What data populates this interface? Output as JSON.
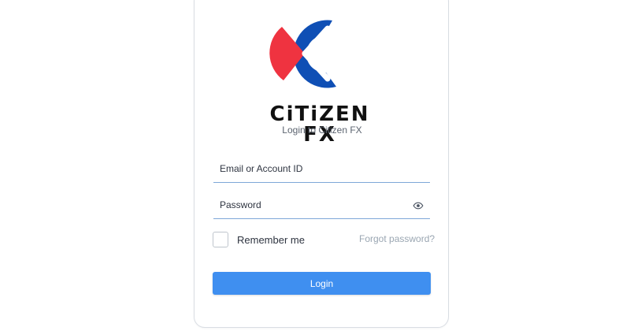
{
  "brand": {
    "name": "CiTiZEN FX",
    "logo": "citizen-fx-logo",
    "colors": {
      "blue": "#0f4fb5",
      "red": "#ef3340",
      "accent": "#3f8ff0"
    }
  },
  "login": {
    "subtitle": "Login to Citizen FX",
    "email_label": "Email or Account ID",
    "password_label": "Password",
    "show_password_icon": "eye-icon",
    "remember_label": "Remember me",
    "forgot_label": "Forgot password?",
    "submit_label": "Login"
  }
}
